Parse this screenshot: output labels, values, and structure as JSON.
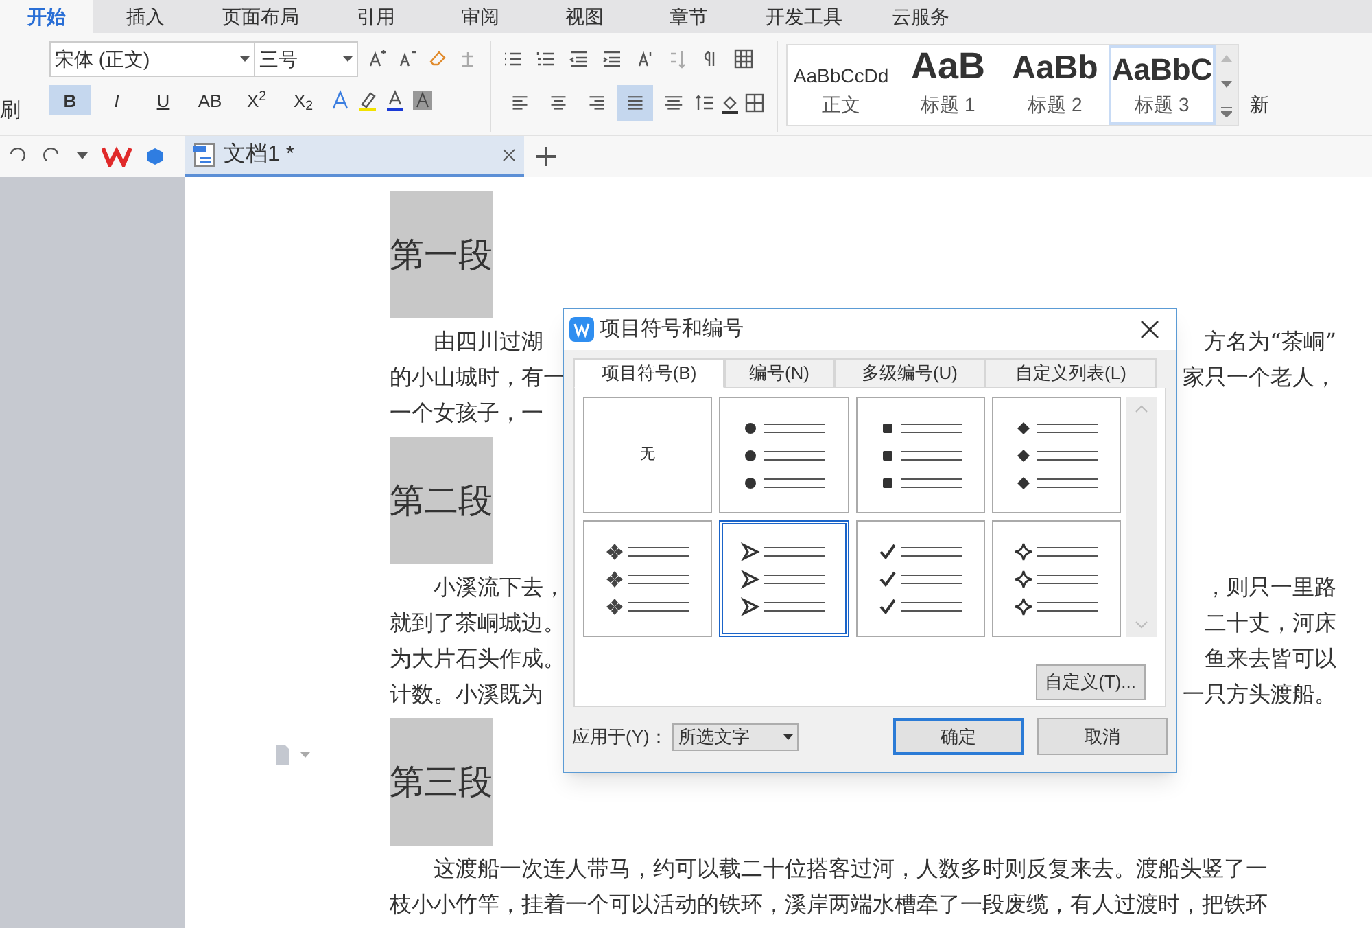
{
  "menu_tabs": [
    {
      "label": "开始",
      "selected": true
    },
    {
      "label": "插入",
      "selected": false
    },
    {
      "label": "页面布局",
      "selected": false
    },
    {
      "label": "引用",
      "selected": false
    },
    {
      "label": "审阅",
      "selected": false
    },
    {
      "label": "视图",
      "selected": false
    },
    {
      "label": "章节",
      "selected": false
    },
    {
      "label": "开发工具",
      "selected": false
    },
    {
      "label": "云服务",
      "selected": false
    }
  ],
  "ribbon": {
    "format_painter": "刷",
    "font": "宋体 (正文)",
    "size": "三号",
    "format_buttons": [
      {
        "label": "B",
        "selected": true
      },
      {
        "label": "I",
        "selected": false
      },
      {
        "label": "U",
        "selected": false
      },
      {
        "label": "AB",
        "selected": false
      },
      {
        "label": "X$^{2}$",
        "selected": false
      },
      {
        "label": "X$_{2}$",
        "selected": false
      }
    ],
    "align_buttons": [
      {
        "kind": "left",
        "selected": false
      },
      {
        "kind": "center",
        "selected": false
      },
      {
        "kind": "right",
        "selected": false
      },
      {
        "kind": "justify",
        "selected": true
      },
      {
        "kind": "distribute",
        "selected": false
      }
    ],
    "styles": [
      {
        "preview": "AaBbCcDd",
        "name": "正文",
        "kind": "body",
        "selected": false
      },
      {
        "preview": "AaB",
        "name": "标题 1",
        "kind": "h1",
        "selected": false
      },
      {
        "preview": "AaBb",
        "name": "标题 2",
        "kind": "h2",
        "selected": false
      },
      {
        "preview": "AaBbC",
        "name": "标题 3",
        "kind": "h3",
        "selected": true
      }
    ],
    "new_style": "新"
  },
  "doc_tab": {
    "title": "文档1 *"
  },
  "document": [
    {
      "kind": "heading",
      "text": "第一段"
    },
    {
      "kind": "para",
      "lines": [
        {
          "left": "由四川过湖",
          "right": "方名为“茶峒”"
        },
        {
          "left": "的小山城时，有一",
          "right": "家只一个老人，"
        },
        {
          "left": "一个女孩子，一"
        }
      ]
    },
    {
      "kind": "heading",
      "text": "第二段"
    },
    {
      "kind": "para",
      "lines": [
        {
          "left": "小溪流下去，",
          "right": "，则只一里路"
        },
        {
          "left": "就到了茶峒城边。",
          "right": "二十丈，河床"
        },
        {
          "left": "为大片石头作成。",
          "right": "鱼来去皆可以"
        },
        {
          "left": "计数。小溪既为",
          "right": "一只方头渡船。"
        }
      ]
    },
    {
      "kind": "heading",
      "text": "第三段"
    },
    {
      "kind": "para",
      "lines": [
        {
          "left": "这渡船一次连人带马，约可以载二十位搭客过河，人数多时则反复来去。渡船头竖了一"
        },
        {
          "left": "枝小小竹竿，挂着一个可以活动的铁环，溪岸两端水槽牵了一段废缆，有人过渡时，把铁环"
        }
      ]
    }
  ],
  "dialog": {
    "title": "项目符号和编号",
    "tabs": [
      {
        "label": "项目符号(B)",
        "selected": true
      },
      {
        "label": "编号(N)",
        "selected": false
      },
      {
        "label": "多级编号(U)",
        "selected": false
      },
      {
        "label": "自定义列表(L)",
        "selected": false
      }
    ],
    "bullets": [
      {
        "kind": "none",
        "label": "无",
        "selected": false
      },
      {
        "kind": "circle",
        "selected": false
      },
      {
        "kind": "square",
        "selected": false
      },
      {
        "kind": "diamond",
        "selected": false
      },
      {
        "kind": "clover",
        "selected": false
      },
      {
        "kind": "arrow",
        "selected": true
      },
      {
        "kind": "check",
        "selected": false
      },
      {
        "kind": "star",
        "selected": false
      }
    ],
    "customize_button": "自定义(T)...",
    "apply_label": "应用于(Y)：",
    "apply_value": "所选文字",
    "ok": "确定",
    "cancel": "取消"
  }
}
